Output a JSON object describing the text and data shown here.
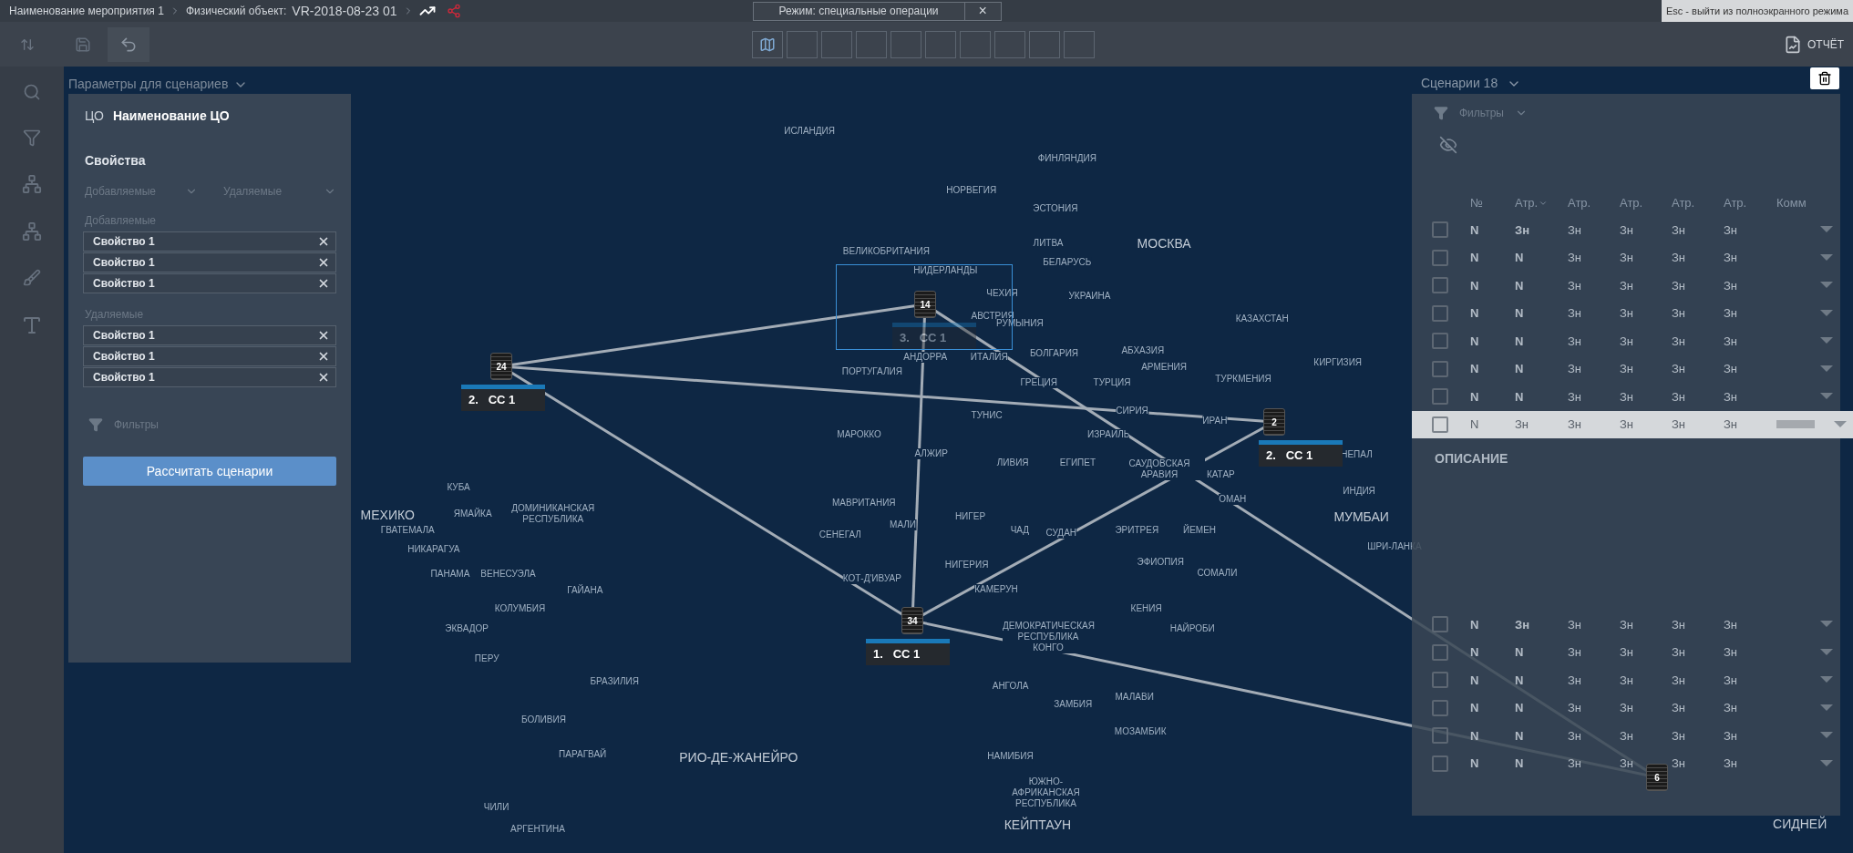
{
  "breadcrumb": [
    {
      "text": "Наименование мероприятия 1"
    },
    {
      "text": "Физический объект:",
      "value": "VR-2018-08-23 01"
    }
  ],
  "mode": {
    "label": "Режим: специальные операции",
    "close": "×"
  },
  "fullscreen_hint": "Esc - выйти из полноэкранного режима",
  "report_button": "ОТЧЁТ",
  "params_panel": {
    "title": "Параметры для сценариев",
    "co_label": "ЦО",
    "co_name": "Наименование ЦО",
    "properties_title": "Свойства",
    "dropdowns": [
      "Добавляемые",
      "Удаляемые"
    ],
    "groups": [
      {
        "label": "Добавляемые",
        "items": [
          "Свойство 1",
          "Свойство 1",
          "Свойство 1"
        ]
      },
      {
        "label": "Удаляемые",
        "items": [
          "Свойство 1",
          "Свойство 1",
          "Свойство 1"
        ]
      }
    ],
    "filters": "Фильтры",
    "calc_button": "Рассчитать сценарии"
  },
  "scenarios_panel": {
    "title": "Сценарии 18",
    "filters": "Фильтры",
    "columns": [
      {
        "label": "№",
        "sorted": false
      },
      {
        "label": "Атр.",
        "sorted": true
      },
      {
        "label": "Атр.",
        "sorted": false
      },
      {
        "label": "Атр.",
        "sorted": false
      },
      {
        "label": "Атр.",
        "sorted": false
      },
      {
        "label": "Атр.",
        "sorted": false
      },
      {
        "label": "Комм",
        "sorted": false
      }
    ],
    "rows": [
      {
        "cells": [
          "N",
          "Зн",
          "Зн",
          "Зн",
          "Зн",
          "Зн"
        ],
        "checked": false,
        "selected": false
      },
      {
        "cells": [
          "N",
          "N",
          "Зн",
          "Зн",
          "Зн",
          "Зн"
        ],
        "checked": false,
        "selected": false
      },
      {
        "cells": [
          "N",
          "N",
          "Зн",
          "Зн",
          "Зн",
          "Зн"
        ],
        "checked": false,
        "selected": false
      },
      {
        "cells": [
          "N",
          "N",
          "Зн",
          "Зн",
          "Зн",
          "Зн"
        ],
        "checked": false,
        "selected": false
      },
      {
        "cells": [
          "N",
          "N",
          "Зн",
          "Зн",
          "Зн",
          "Зн"
        ],
        "checked": false,
        "selected": false
      },
      {
        "cells": [
          "N",
          "N",
          "Зн",
          "Зн",
          "Зн",
          "Зн"
        ],
        "checked": false,
        "selected": false
      },
      {
        "cells": [
          "N",
          "N",
          "Зн",
          "Зн",
          "Зн",
          "Зн"
        ],
        "checked": false,
        "selected": false
      },
      {
        "cells": [
          "N",
          "Зн",
          "Зн",
          "Зн",
          "Зн",
          "Зн"
        ],
        "checked": false,
        "selected": true
      }
    ],
    "description_title": "ОПИСАНИЕ",
    "rows_below": [
      {
        "cells": [
          "N",
          "Зн",
          "Зн",
          "Зн",
          "Зн",
          "Зн"
        ],
        "checked": false,
        "selected": false
      },
      {
        "cells": [
          "N",
          "N",
          "Зн",
          "Зн",
          "Зн",
          "Зн"
        ],
        "checked": false,
        "selected": false
      },
      {
        "cells": [
          "N",
          "N",
          "Зн",
          "Зн",
          "Зн",
          "Зн"
        ],
        "checked": false,
        "selected": false
      },
      {
        "cells": [
          "N",
          "N",
          "Зн",
          "Зн",
          "Зн",
          "Зн"
        ],
        "checked": false,
        "selected": false
      },
      {
        "cells": [
          "N",
          "N",
          "Зн",
          "Зн",
          "Зн",
          "Зн"
        ],
        "checked": false,
        "selected": false
      },
      {
        "cells": [
          "N",
          "N",
          "Зн",
          "Зн",
          "Зн",
          "Зн"
        ],
        "checked": false,
        "selected": false
      }
    ]
  },
  "map": {
    "nodes": [
      {
        "count": "24",
        "number": "2.",
        "name": "СС 1",
        "selected": false
      },
      {
        "count": "14",
        "number": "3.",
        "name": "СС 1",
        "selected": true
      },
      {
        "count": "2",
        "number": "2.",
        "name": "СС 1",
        "selected": false
      },
      {
        "count": "34",
        "number": "1.",
        "name": "СС 1",
        "selected": false
      },
      {
        "count": "6",
        "selected": false
      }
    ],
    "labels": [
      {
        "text": "ИСЛАНДИЯ",
        "kind": "country"
      },
      {
        "text": "ФИНЛЯНДИЯ",
        "kind": "country"
      },
      {
        "text": "НОРВЕГИЯ",
        "kind": "country"
      },
      {
        "text": "ЭСТОНИЯ",
        "kind": "country"
      },
      {
        "text": "ВЕЛИКОБРИТАНИЯ",
        "kind": "country"
      },
      {
        "text": "ЛИТВА",
        "kind": "country"
      },
      {
        "text": "МОСКВА",
        "kind": "city"
      },
      {
        "text": "БЕЛАРУСЬ",
        "kind": "country"
      },
      {
        "text": "НИДЕРЛАНДЫ",
        "kind": "country"
      },
      {
        "text": "ЧЕХИЯ",
        "kind": "country"
      },
      {
        "text": "УКРАИНА",
        "kind": "country"
      },
      {
        "text": "АВСТРИЯ",
        "kind": "country"
      },
      {
        "text": "КАЗАХСТАН",
        "kind": "country"
      },
      {
        "text": "РУМЫНИЯ",
        "kind": "country"
      },
      {
        "text": "АНДОРРА",
        "kind": "country"
      },
      {
        "text": "ИТАЛИЯ",
        "kind": "country"
      },
      {
        "text": "БОЛГАРИЯ",
        "kind": "country"
      },
      {
        "text": "АБХАЗИЯ",
        "kind": "country"
      },
      {
        "text": "КИРГИЗИЯ",
        "kind": "country"
      },
      {
        "text": "АРМЕНИЯ",
        "kind": "country"
      },
      {
        "text": "ПОРТУГАЛИЯ",
        "kind": "country"
      },
      {
        "text": "ТУРКМЕНИЯ",
        "kind": "country"
      },
      {
        "text": "ГРЕЦИЯ",
        "kind": "country"
      },
      {
        "text": "ТУРЦИЯ",
        "kind": "country"
      },
      {
        "text": "ТУНИС",
        "kind": "country"
      },
      {
        "text": "СИРИЯ",
        "kind": "country"
      },
      {
        "text": "ИРАН",
        "kind": "country"
      },
      {
        "text": "МАРОККО",
        "kind": "country"
      },
      {
        "text": "ИЗРАИЛЬ",
        "kind": "country"
      },
      {
        "text": "АЛЖИР",
        "kind": "country"
      },
      {
        "text": "НЕПАЛ",
        "kind": "country"
      },
      {
        "text": "ЛИВИЯ",
        "kind": "country"
      },
      {
        "text": "ЕГИПЕТ",
        "kind": "country"
      },
      {
        "text": "САУДОВСКАЯ АРАВИЯ",
        "kind": "country"
      },
      {
        "text": "КАТАР",
        "kind": "country"
      },
      {
        "text": "ИНДИЯ",
        "kind": "country"
      },
      {
        "text": "ОМАН",
        "kind": "country"
      },
      {
        "text": "МАВРИТАНИЯ",
        "kind": "country"
      },
      {
        "text": "НИГЕР",
        "kind": "country"
      },
      {
        "text": "МУМБАИ",
        "kind": "city"
      },
      {
        "text": "МАЛИ",
        "kind": "country"
      },
      {
        "text": "ЧАД",
        "kind": "country"
      },
      {
        "text": "СУДАН",
        "kind": "country"
      },
      {
        "text": "ЭРИТРЕЯ",
        "kind": "country"
      },
      {
        "text": "ЙЕМЕН",
        "kind": "country"
      },
      {
        "text": "СЕНЕГАЛ",
        "kind": "country"
      },
      {
        "text": "ШРИ-ЛАНКА",
        "kind": "country"
      },
      {
        "text": "ЭФИОПИЯ",
        "kind": "country"
      },
      {
        "text": "НИГЕРИЯ",
        "kind": "country"
      },
      {
        "text": "СОМАЛИ",
        "kind": "country"
      },
      {
        "text": "КОТ-Д'ИВУАР",
        "kind": "country"
      },
      {
        "text": "КАМЕРУН",
        "kind": "country"
      },
      {
        "text": "КЕНИЯ",
        "kind": "country"
      },
      {
        "text": "ДЕМОКРАТИЧЕСКАЯ РЕСПУБЛИКА КОНГО",
        "kind": "country"
      },
      {
        "text": "НАЙРОБИ",
        "kind": "country"
      },
      {
        "text": "АНГОЛА",
        "kind": "country"
      },
      {
        "text": "МАЛАВИ",
        "kind": "country"
      },
      {
        "text": "ЗАМБИЯ",
        "kind": "country"
      },
      {
        "text": "МОЗАМБИК",
        "kind": "country"
      },
      {
        "text": "НАМИБИЯ",
        "kind": "country"
      },
      {
        "text": "ЮЖНО-АФРИКАНСКАЯ РЕСПУБЛИКА",
        "kind": "country"
      },
      {
        "text": "КЕЙПТАУН",
        "kind": "city"
      },
      {
        "text": "КУБА",
        "kind": "country"
      },
      {
        "text": "МЕХИКО",
        "kind": "city"
      },
      {
        "text": "ЯМАЙКА",
        "kind": "country"
      },
      {
        "text": "ДОМИНИКАНСКАЯ РЕСПУБЛИКА",
        "kind": "country"
      },
      {
        "text": "ГВАТЕМАЛА",
        "kind": "country"
      },
      {
        "text": "НИКАРАГУА",
        "kind": "country"
      },
      {
        "text": "ПАНАМА",
        "kind": "country"
      },
      {
        "text": "ВЕНЕСУЭЛА",
        "kind": "country"
      },
      {
        "text": "ГАЙАНА",
        "kind": "country"
      },
      {
        "text": "КОЛУМБИЯ",
        "kind": "country"
      },
      {
        "text": "ЭКВАДОР",
        "kind": "country"
      },
      {
        "text": "ПЕРУ",
        "kind": "country"
      },
      {
        "text": "БРАЗИЛИЯ",
        "kind": "country"
      },
      {
        "text": "БОЛИВИЯ",
        "kind": "country"
      },
      {
        "text": "ПАРАГВАЙ",
        "kind": "country"
      },
      {
        "text": "РИО-ДЕ-ЖАНЕЙРО",
        "kind": "city"
      },
      {
        "text": "ЧИЛИ",
        "kind": "country"
      },
      {
        "text": "АРГЕНТИНА",
        "kind": "country"
      },
      {
        "text": "СИДНЕЙ",
        "kind": "city"
      }
    ]
  }
}
